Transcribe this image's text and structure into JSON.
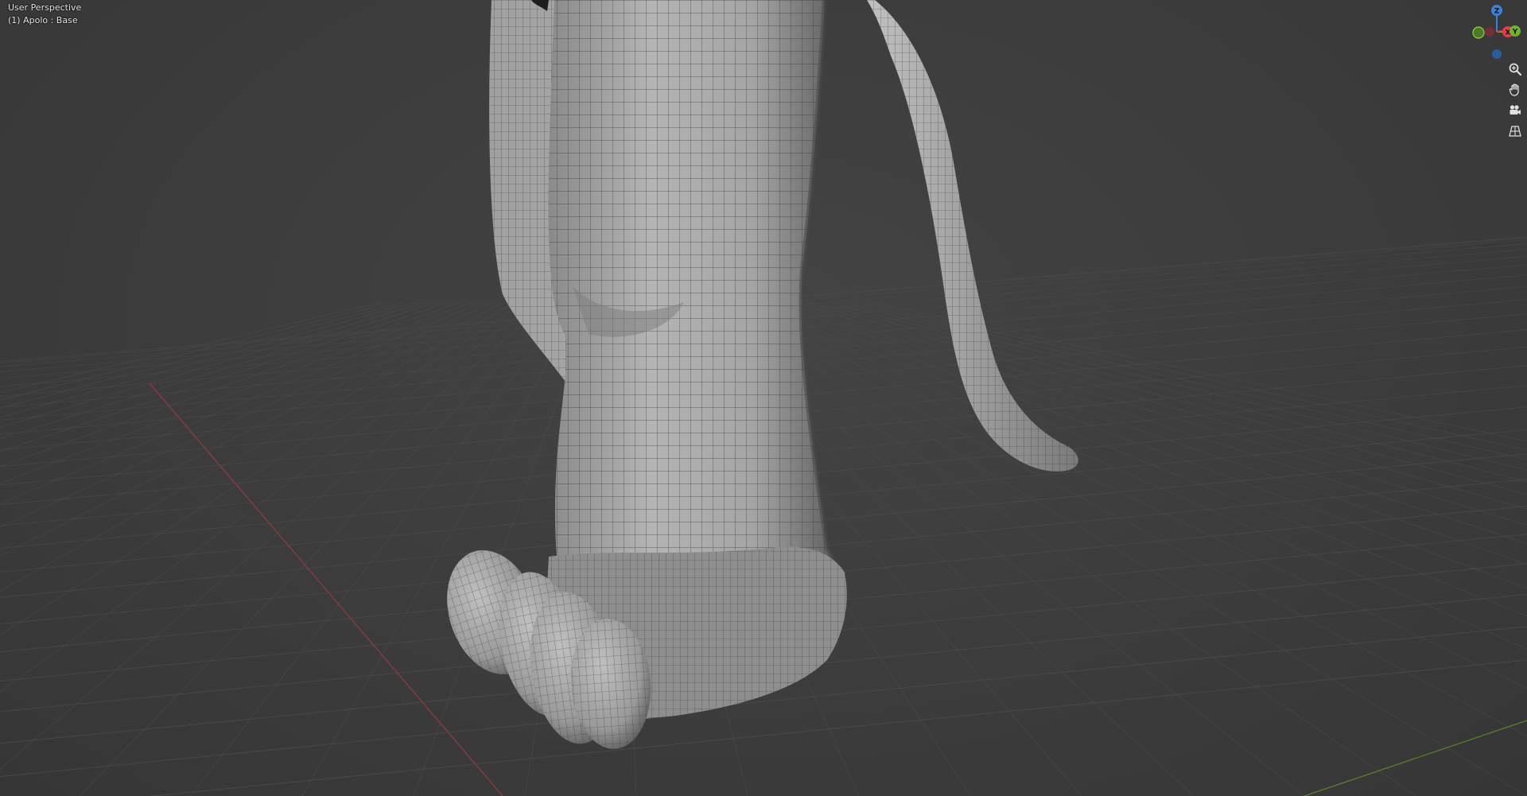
{
  "viewport": {
    "view_name": "User Perspective",
    "object_info": "(1) Apolo : Base"
  },
  "gizmo": {
    "axis_z": "Z",
    "axis_x": "X",
    "axis_y": "Y",
    "color_x": "#e63c50",
    "color_y": "#6fb52b",
    "color_z": "#3b82d9"
  },
  "nav_icons": [
    "zoom-icon",
    "pan-hand-icon",
    "camera-icon",
    "ortho-grid-icon"
  ],
  "colors": {
    "background": "#3d3d3d",
    "grid": "#4e4e4e",
    "mesh_light": "#b9b9b9",
    "mesh_dark": "#6e6e6e",
    "wire": "#2f2f2f"
  }
}
